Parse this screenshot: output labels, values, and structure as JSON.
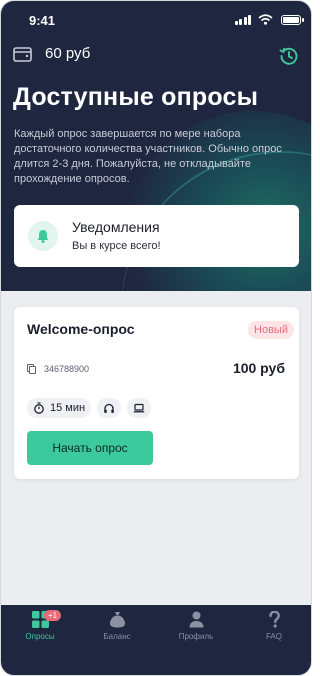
{
  "status_bar": {
    "time": "9:41"
  },
  "header": {
    "balance": "60 руб",
    "icons": [
      "wallet-icon",
      "history-icon"
    ]
  },
  "main": {
    "title": "Доступные опросы",
    "description": "Каждый опрос завершается по мере набора достаточного количества участников. Обычно опрос длится 2-3 дня. Пожалуйста, не откладывайте прохождение опросов."
  },
  "notification": {
    "title": "Уведомления",
    "subtitle": "Вы в курсе всего!",
    "icon": "bell-icon"
  },
  "survey": {
    "title": "Welcome-опрос",
    "badge": "Новый",
    "code": "346788900",
    "price": "100 руб",
    "duration": "15 мин",
    "start_label": "Начать опрос"
  },
  "tabbar": {
    "items": [
      {
        "label": "Опросы",
        "icon": "grid-icon",
        "badge": "+1",
        "active": true
      },
      {
        "label": "Баланс",
        "icon": "moneybag-icon"
      },
      {
        "label": "Профиль",
        "icon": "person-icon"
      },
      {
        "label": "FAQ",
        "icon": "question-icon"
      }
    ]
  },
  "colors": {
    "navy": "#1f2640",
    "accent": "#3cc99b",
    "badge_text": "#e26f7d",
    "badge_bg": "#fde4e7"
  }
}
